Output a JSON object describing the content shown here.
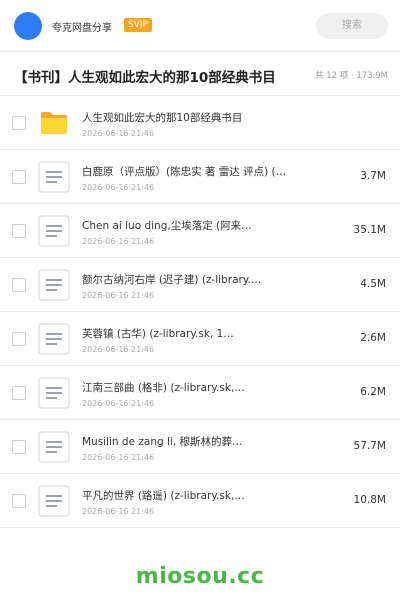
{
  "header": {
    "brand": "夸克网盘分享",
    "badge": "SVIP",
    "search_placeholder": "搜索"
  },
  "page_title": "【书刊】人生观如此宏大的那10部经典书目",
  "meta": "共 12 项 · 173.9M",
  "files": [
    {
      "name": "人生观如此宏大的那10部经典书目",
      "date": "2026-06-16 21:46",
      "size": "",
      "icon": "folder-icon"
    },
    {
      "name": "白鹿原（评点版）(陈忠实 著 雷达 评点) (…",
      "date": "2026-06-16 21:46",
      "size": "3.7M",
      "icon": "document-icon"
    },
    {
      "name": "Chen ai luo ding,尘埃落定 (阿来…",
      "date": "2026-06-16 21:46",
      "size": "35.1M",
      "icon": "document-icon"
    },
    {
      "name": "额尔古纳河右岸 (迟子建) (z-library.…",
      "date": "2026-06-16 21:46",
      "size": "4.5M",
      "icon": "document-icon"
    },
    {
      "name": "芙蓉镇 (古华) (z-library.sk, 1…",
      "date": "2026-06-16 21:46",
      "size": "2.6M",
      "icon": "document-icon"
    },
    {
      "name": "江南三部曲 (格非) (z-library.sk,…",
      "date": "2026-06-16 21:46",
      "size": "6.2M",
      "icon": "document-icon"
    },
    {
      "name": "Musilin de zang li, 穆斯林的葬…",
      "date": "2026-06-16 21:46",
      "size": "57.7M",
      "icon": "document-icon"
    },
    {
      "name": "平凡的世界 (路遥) (z-library.sk,…",
      "date": "2026-06-16 21:46",
      "size": "10.8M",
      "icon": "document-icon"
    }
  ],
  "watermark": "miosou.cc",
  "colors": {
    "accent": "#2f7cf6",
    "svip": "#f5a623",
    "folder": "#fbc02d",
    "watermark": "#4cb648"
  }
}
